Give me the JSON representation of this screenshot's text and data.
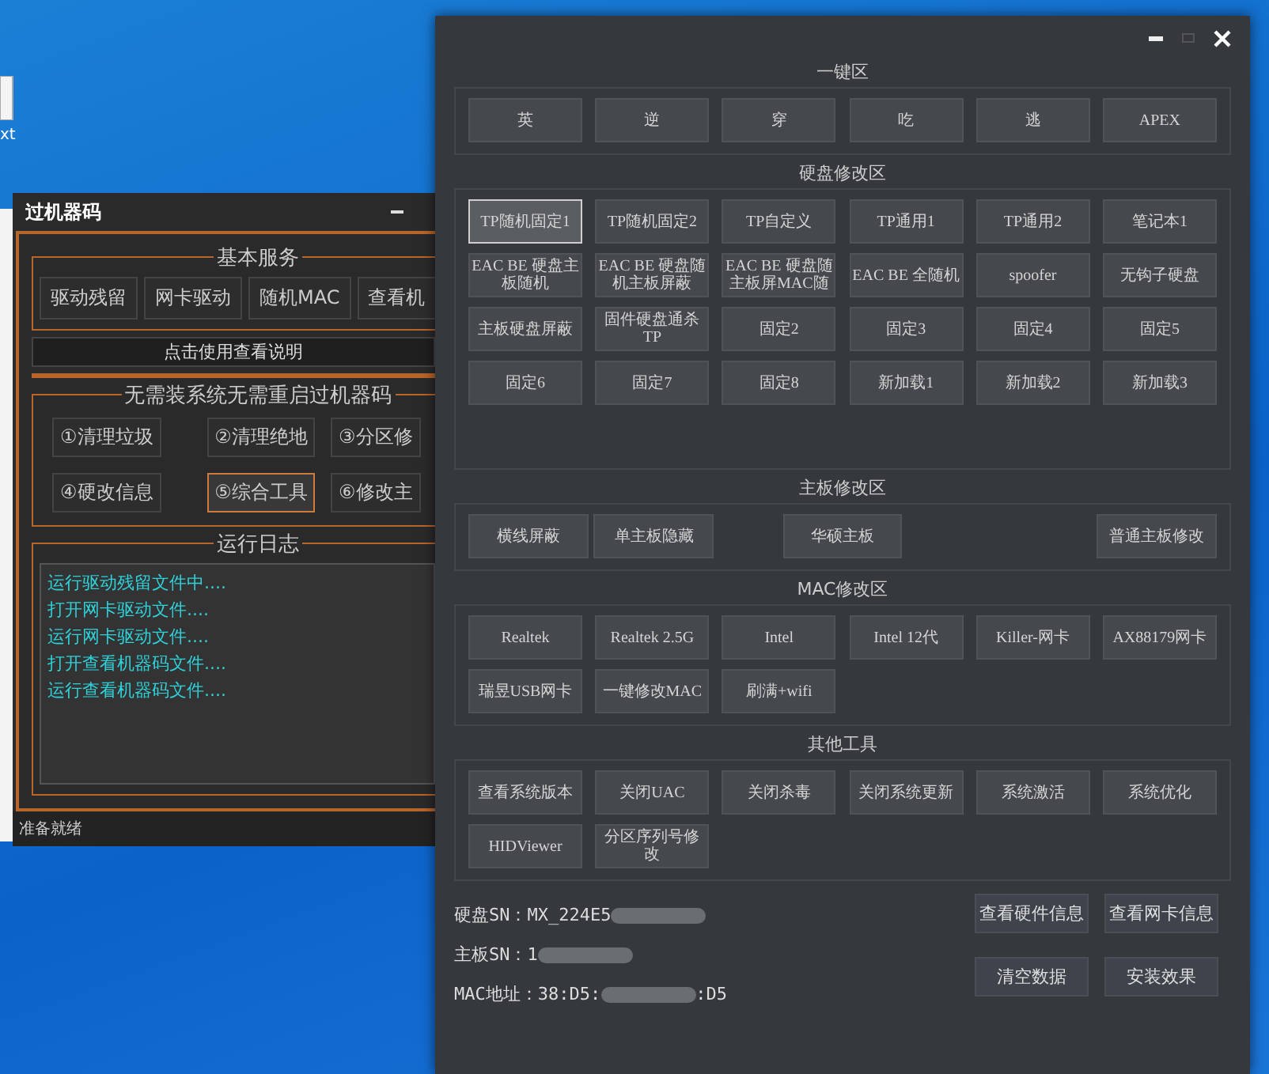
{
  "desktop": {
    "icon_label": "xt"
  },
  "tool_window": {
    "title": "过机器码",
    "basic_services": {
      "title": "基本服务",
      "buttons": [
        {
          "label": "驱动残留",
          "focused": false
        },
        {
          "label": "网卡驱动",
          "focused": false
        },
        {
          "label": "随机MAC",
          "focused": false
        },
        {
          "label": "查看机",
          "focused": false
        }
      ]
    },
    "help_button": "点击使用查看说明",
    "no_reinstall": {
      "title": "无需装系统无需重启过机器码",
      "buttons": [
        {
          "label": "①清理垃圾",
          "focused": false
        },
        {
          "label": "②清理绝地",
          "focused": false
        },
        {
          "label": "③分区修",
          "focused": false
        },
        {
          "label": "④硬改信息",
          "focused": false
        },
        {
          "label": "⑤综合工具",
          "focused": true
        },
        {
          "label": "⑥修改主",
          "focused": false
        }
      ]
    },
    "log": {
      "title": "运行日志",
      "lines": [
        "运行驱动残留文件中....",
        "打开网卡驱动文件....",
        "运行网卡驱动文件....",
        "打开查看机器码文件....",
        "运行查看机器码文件...."
      ]
    },
    "status": "准备就绪"
  },
  "main_window": {
    "sections": [
      {
        "title": "一键区",
        "kind": "grid",
        "rows": [
          [
            {
              "label": "英",
              "focused": false
            },
            {
              "label": "逆",
              "focused": false
            },
            {
              "label": "穿",
              "focused": false
            },
            {
              "label": "吃",
              "focused": false
            },
            {
              "label": "逃",
              "focused": false
            },
            {
              "label": "APEX",
              "focused": false
            }
          ]
        ]
      },
      {
        "title": "硬盘修改区",
        "kind": "grid",
        "rows": [
          [
            {
              "label": "TP随机固定1",
              "focused": true
            },
            {
              "label": "TP随机固定2",
              "focused": false
            },
            {
              "label": "TP自定义",
              "focused": false
            },
            {
              "label": "TP通用1",
              "focused": false
            },
            {
              "label": "TP通用2",
              "focused": false
            },
            {
              "label": "笔记本1",
              "focused": false
            }
          ],
          [
            {
              "label": "EAC BE 硬盘主板随机",
              "focused": false
            },
            {
              "label": "EAC BE 硬盘随机主板屏蔽",
              "focused": false
            },
            {
              "label": "EAC BE 硬盘随主板屏MAC随",
              "focused": false
            },
            {
              "label": "EAC BE 全随机",
              "focused": false
            },
            {
              "label": "spoofer",
              "focused": false
            },
            {
              "label": "无钩子硬盘",
              "focused": false
            }
          ],
          [
            {
              "label": "主板硬盘屏蔽",
              "focused": false
            },
            {
              "label": "固件硬盘通杀TP",
              "focused": false
            },
            {
              "label": "固定2",
              "focused": false
            },
            {
              "label": "固定3",
              "focused": false
            },
            {
              "label": "固定4",
              "focused": false
            },
            {
              "label": "固定5",
              "focused": false
            }
          ],
          [
            {
              "label": "固定6",
              "focused": false
            },
            {
              "label": "固定7",
              "focused": false
            },
            {
              "label": "固定8",
              "focused": false
            },
            {
              "label": "新加载1",
              "focused": false
            },
            {
              "label": "新加载2",
              "focused": false
            },
            {
              "label": "新加载3",
              "focused": false
            }
          ]
        ]
      },
      {
        "title": "主板修改区",
        "kind": "spread",
        "rows": [
          [
            {
              "label": "横线屏蔽",
              "focused": false
            },
            {
              "label": "单主板隐藏",
              "focused": false
            },
            {
              "label": "华硕主板",
              "focused": false
            },
            {
              "label": "普通主板修改",
              "focused": false
            }
          ]
        ]
      },
      {
        "title": "MAC修改区",
        "kind": "grid",
        "rows": [
          [
            {
              "label": "Realtek",
              "focused": false
            },
            {
              "label": "Realtek 2.5G",
              "focused": false
            },
            {
              "label": "Intel",
              "focused": false
            },
            {
              "label": "Intel 12代",
              "focused": false
            },
            {
              "label": "Killer-网卡",
              "focused": false
            },
            {
              "label": "AX88179网卡",
              "focused": false
            }
          ],
          [
            {
              "label": "瑞昱USB网卡",
              "focused": false
            },
            {
              "label": "一键修改MAC",
              "focused": false
            },
            {
              "label": "刷满+wifi",
              "focused": false
            }
          ]
        ]
      },
      {
        "title": "其他工具",
        "kind": "grid",
        "rows": [
          [
            {
              "label": "查看系统版本",
              "focused": false
            },
            {
              "label": "关闭UAC",
              "focused": false
            },
            {
              "label": "关闭杀毒",
              "focused": false
            },
            {
              "label": "关闭系统更新",
              "focused": false
            },
            {
              "label": "系统激活",
              "focused": false
            },
            {
              "label": "系统优化",
              "focused": false
            }
          ],
          [
            {
              "label": "HIDViewer",
              "focused": false
            },
            {
              "label": "分区序列号修改",
              "focused": false
            }
          ]
        ]
      }
    ],
    "info": [
      {
        "label": "硬盘SN：",
        "value": "MX_224E5",
        "redacted": true
      },
      {
        "label": "主板SN：",
        "value": "1",
        "redacted": true
      },
      {
        "label": "MAC地址：",
        "value": "38:D5:",
        "redacted": true,
        "suffix": ":D5"
      }
    ],
    "actions": [
      "查看硬件信息",
      "查看网卡信息",
      "清空数据",
      "安装效果"
    ]
  }
}
